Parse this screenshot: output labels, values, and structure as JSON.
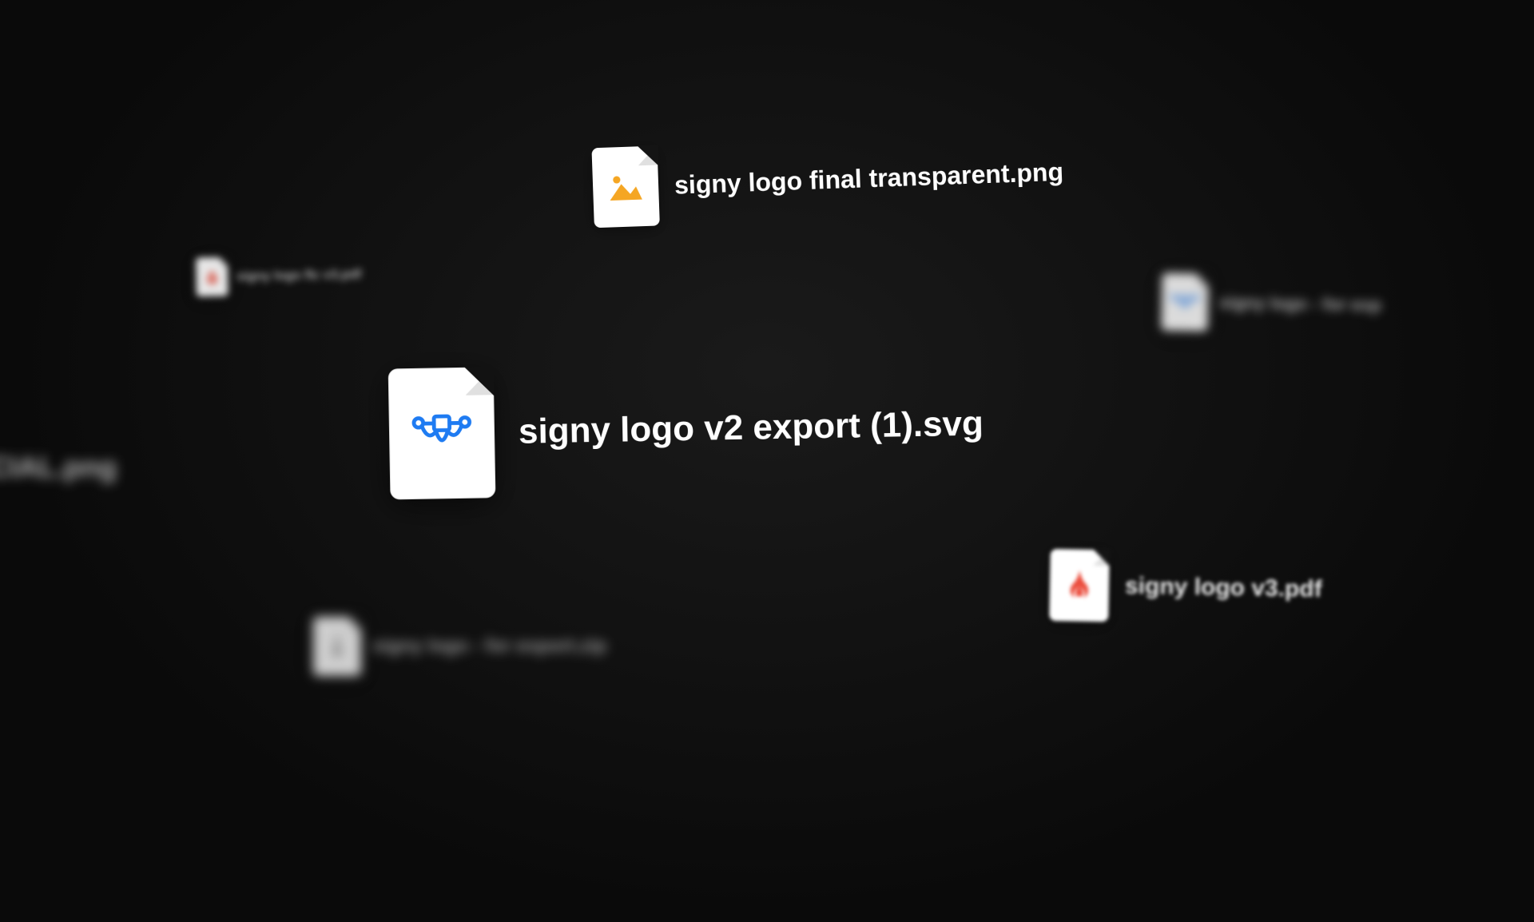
{
  "files": {
    "png_top": {
      "name": "signy logo final transparent.png",
      "type": "png"
    },
    "svg_main": {
      "name": "signy logo v2 export (1).svg",
      "type": "svg"
    },
    "pdf_small": {
      "name": "signy logo flc v3.pdf",
      "type": "pdf"
    },
    "svg_right": {
      "name": "signy logo - for exp",
      "type": "svg"
    },
    "png_left": {
      "name": "go SOCIAL.png",
      "type": "png"
    },
    "pdf_right": {
      "name": "signy logo v3.pdf",
      "type": "pdf"
    },
    "zip": {
      "name": "signy logo - for export.zip",
      "type": "zip"
    }
  },
  "colors": {
    "image_accent": "#F5A623",
    "pdf_accent": "#EB4D3D",
    "vector_accent": "#1E7BF2",
    "zip_accent": "#6B6B6B"
  }
}
